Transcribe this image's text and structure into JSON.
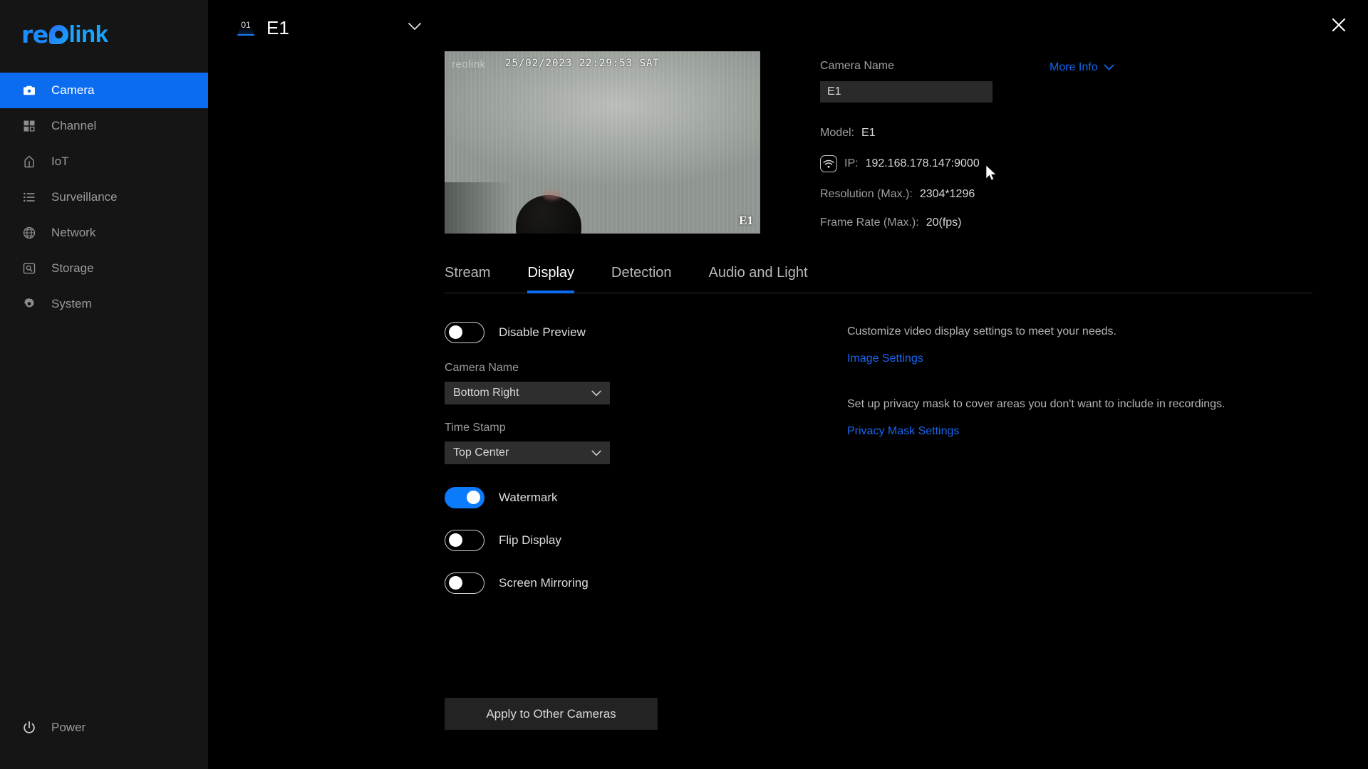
{
  "brand": {
    "name_part1": "re",
    "name_part2": "link"
  },
  "sidebar": {
    "items": [
      {
        "label": "Camera",
        "icon": "camera-icon",
        "active": true
      },
      {
        "label": "Channel",
        "icon": "grid-icon",
        "active": false
      },
      {
        "label": "IoT",
        "icon": "home-icon",
        "active": false
      },
      {
        "label": "Surveillance",
        "icon": "list-icon",
        "active": false
      },
      {
        "label": "Network",
        "icon": "globe-icon",
        "active": false
      },
      {
        "label": "Storage",
        "icon": "disk-icon",
        "active": false
      },
      {
        "label": "System",
        "icon": "gear-icon",
        "active": false
      }
    ],
    "power_label": "Power"
  },
  "topbar": {
    "channel_number": "01",
    "camera_title": "E1",
    "close_label": "×"
  },
  "preview": {
    "overlay_logo": "reolink",
    "overlay_timestamp": "25/02/2023 22:29:53 SAT",
    "overlay_watermark": "E1"
  },
  "info": {
    "camera_name_label": "Camera Name",
    "camera_name_value": "E1",
    "more_info_label": "More Info",
    "model_label": "Model:",
    "model_value": "E1",
    "ip_label": "IP:",
    "ip_value": "192.168.178.147:9000",
    "resolution_label": "Resolution (Max.):",
    "resolution_value": "2304*1296",
    "framerate_label": "Frame Rate (Max.):",
    "framerate_value": "20(fps)"
  },
  "tabs": [
    {
      "label": "Stream",
      "active": false
    },
    {
      "label": "Display",
      "active": true
    },
    {
      "label": "Detection",
      "active": false
    },
    {
      "label": "Audio and Light",
      "active": false
    }
  ],
  "display_settings": {
    "disable_preview": {
      "label": "Disable Preview",
      "state": "off"
    },
    "camera_name_field": {
      "label": "Camera Name",
      "value": "Bottom Right"
    },
    "time_stamp_field": {
      "label": "Time Stamp",
      "value": "Top Center"
    },
    "watermark": {
      "label": "Watermark",
      "state": "on"
    },
    "flip_display": {
      "label": "Flip Display",
      "state": "off"
    },
    "screen_mirroring": {
      "label": "Screen Mirroring",
      "state": "off"
    },
    "apply_button": "Apply to Other Cameras"
  },
  "right_panel": {
    "image_desc": "Customize video display settings to meet your needs.",
    "image_link": "Image Settings",
    "privacy_desc": "Set up privacy mask to cover areas you don't want to include in recordings.",
    "privacy_link": "Privacy Mask Settings"
  },
  "colors": {
    "accent": "#0b6cf0",
    "link": "#1767f0",
    "toggle_on": "#0b7bfb",
    "sidebar_bg": "#151515",
    "page_bg": "#000000"
  }
}
